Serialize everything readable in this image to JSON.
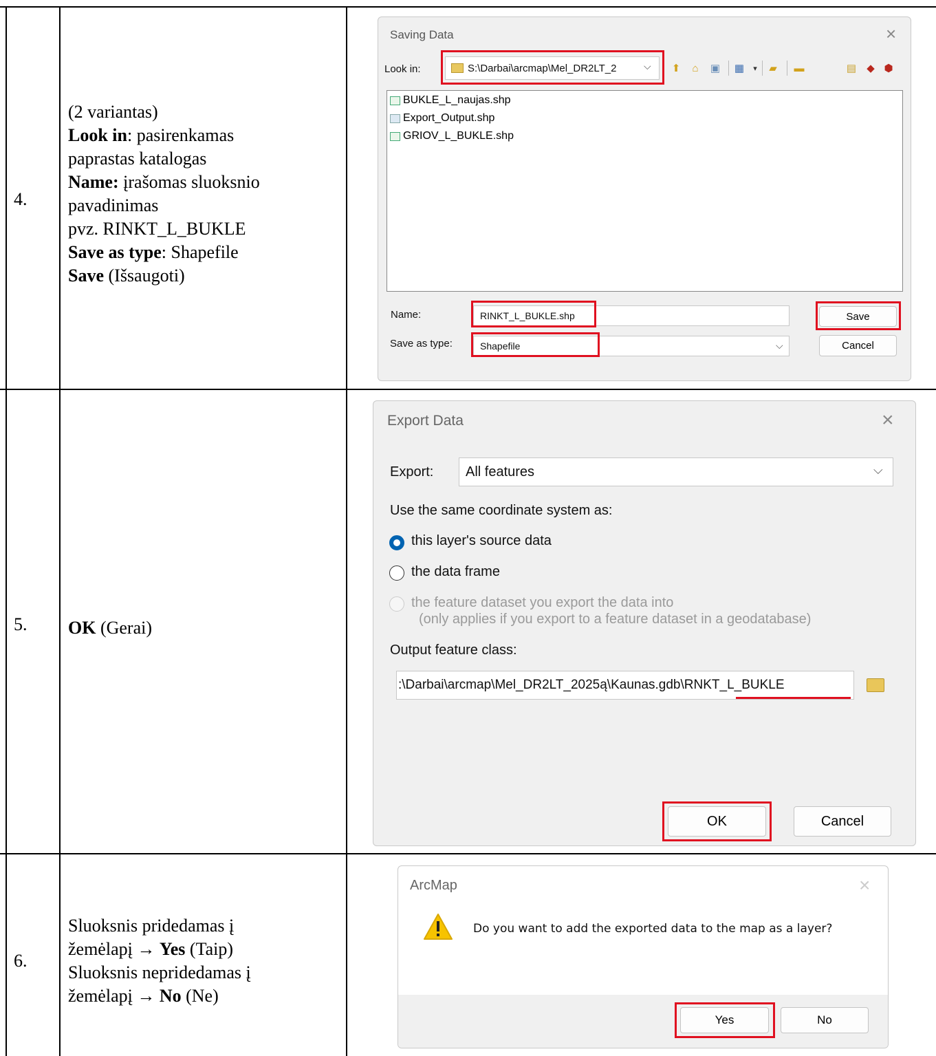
{
  "rows": [
    {
      "number": "4.",
      "desc_lines": [
        {
          "parts": [
            {
              "t": "(2 variantas)",
              "b": false
            }
          ]
        },
        {
          "parts": [
            {
              "t": "Look in",
              "b": true
            },
            {
              "t": ": pasirenkamas",
              "b": false
            }
          ]
        },
        {
          "parts": [
            {
              "t": "paprastas katalogas",
              "b": false
            }
          ]
        },
        {
          "parts": [
            {
              "t": "Name:",
              "b": true
            },
            {
              "t": " įrašomas sluoksnio",
              "b": false
            }
          ]
        },
        {
          "parts": [
            {
              "t": "pavadinimas",
              "b": false
            }
          ]
        },
        {
          "parts": [
            {
              "t": "pvz. RINKT_L_BUKLE",
              "b": false
            }
          ]
        },
        {
          "parts": [
            {
              "t": "Save as type",
              "b": true
            },
            {
              "t": ": Shapefile",
              "b": false
            }
          ]
        },
        {
          "parts": [
            {
              "t": "Save",
              "b": true
            },
            {
              "t": " (Išsaugoti)",
              "b": false
            }
          ]
        }
      ]
    },
    {
      "number": "5.",
      "desc_lines": [
        {
          "parts": [
            {
              "t": "OK",
              "b": true
            },
            {
              "t": " (Gerai)",
              "b": false
            }
          ]
        }
      ]
    },
    {
      "number": "6.",
      "desc_lines": [
        {
          "parts": [
            {
              "t": "Sluoksnis pridedamas į",
              "b": false
            }
          ]
        },
        {
          "parts": [
            {
              "t": "žemėlapį → ",
              "b": false
            },
            {
              "t": "Yes",
              "b": true
            },
            {
              "t": " (Taip)",
              "b": false
            }
          ]
        },
        {
          "parts": [
            {
              "t": "Sluoksnis nepridedamas į",
              "b": false
            }
          ]
        },
        {
          "parts": [
            {
              "t": "žemėlapį → ",
              "b": false
            },
            {
              "t": "No",
              "b": true
            },
            {
              "t": " (Ne)",
              "b": false
            }
          ]
        }
      ]
    }
  ],
  "saving_dialog": {
    "title": "Saving Data",
    "close": "×",
    "look_in_label": "Look in:",
    "look_in_value": "S:\\Darbai\\arcmap\\Mel_DR2LT_2",
    "files": [
      "BUKLE_L_naujas.shp",
      "Export_Output.shp",
      "GRIOV_L_BUKLE.shp"
    ],
    "name_label": "Name:",
    "name_value": "RINKT_L_BUKLE.shp",
    "type_label": "Save as type:",
    "type_value": "Shapefile",
    "save_button": "Save",
    "cancel_button": "Cancel"
  },
  "export_dialog": {
    "title": "Export Data",
    "close": "×",
    "export_label": "Export:",
    "export_value": "All features",
    "coord_label": "Use the same coordinate system as:",
    "radio1": "this layer's source data",
    "radio2": "the data frame",
    "radio3": "the feature dataset you export the data into",
    "radio3_note": "(only applies if you export to a feature dataset in a geodatabase)",
    "output_label": "Output feature class:",
    "output_path": ":\\Darbai\\arcmap\\Mel_DR2LT_2025ą\\Kaunas.gdb\\",
    "output_name": "RNKT_L_BUKLE",
    "ok_button": "OK",
    "cancel_button": "Cancel"
  },
  "arcmap_dialog": {
    "title": "ArcMap",
    "close": "×",
    "message": "Do you want to add the exported data to the map as a layer?",
    "yes_button": "Yes",
    "no_button": "No"
  },
  "colors": {
    "highlight": "#e01020",
    "accent": "#0063b1",
    "warning": "#f7c300"
  }
}
